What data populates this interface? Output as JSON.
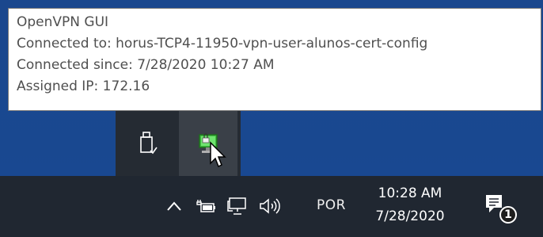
{
  "tooltip": {
    "title": "OpenVPN GUI",
    "connected_to": "Connected to: horus-TCP4-11950-vpn-user-alunos-cert-config",
    "connected_since": "Connected since: 7/28/2020 10:27 AM",
    "assigned_ip": "Assigned IP: 172.16"
  },
  "tray_overflow": {
    "items": [
      {
        "icon": "usb-safely-remove-icon"
      },
      {
        "icon": "openvpn-connected-icon"
      }
    ]
  },
  "taskbar": {
    "language": "POR",
    "time": "10:28 AM",
    "date": "7/28/2020",
    "notification_count": "1"
  },
  "colors": {
    "desktop": "#1a478d",
    "taskbar": "#202731",
    "flyout": "#252b33",
    "vpn_green": "#3fbf3f"
  }
}
